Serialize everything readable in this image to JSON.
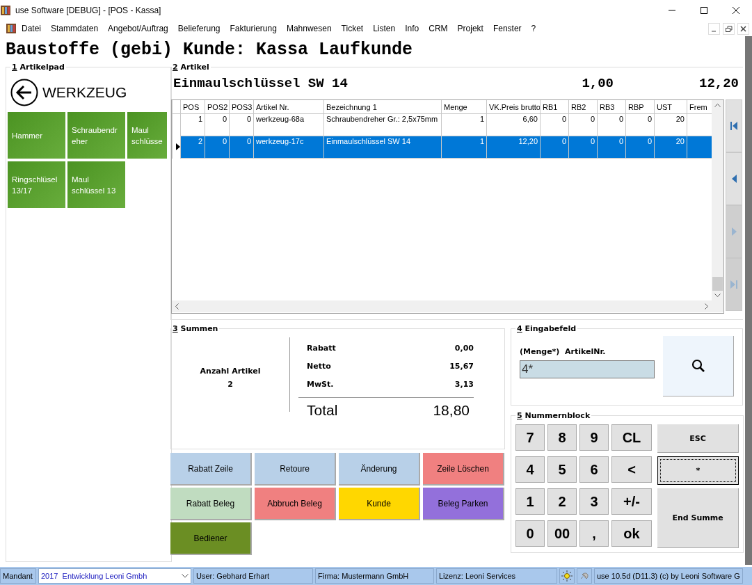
{
  "window": {
    "title": "use Software [DEBUG] - [POS - Kassa]"
  },
  "menu": [
    "Datei",
    "Stammdaten",
    "Angebot/Auftrag",
    "Belieferung",
    "Fakturierung",
    "Mahnwesen",
    "Ticket",
    "Listen",
    "Info",
    "CRM",
    "Projekt",
    "Fenster",
    "?"
  ],
  "heading": "Baustoffe (gebi) Kunde: Kassa Laufkunde",
  "artikelpad": {
    "key": "1",
    "title": "Artikelpad",
    "category": "WERKZEUG",
    "tiles": [
      {
        "label": "Hammer"
      },
      {
        "label": "Schraubendreher"
      },
      {
        "label": "Maul schlüsse"
      },
      {
        "label": "Ringschlüsel 13/17"
      },
      {
        "label": "Maul schlüssel 13"
      }
    ]
  },
  "artikel": {
    "key": "2",
    "title": "Artikel",
    "current": {
      "name": "Einmaulschlüssel  SW 14",
      "quantity": "1,00",
      "price": "12,20"
    },
    "table": {
      "columns": [
        "POS",
        "POS2",
        "POS3",
        "Artikel Nr.",
        "Bezeichnung 1",
        "Menge",
        "VK.Preis brutto",
        "RB1",
        "RB2",
        "RB3",
        "RBP",
        "UST",
        "Frem"
      ],
      "rows": [
        {
          "selected": false,
          "cells": [
            "1",
            "0",
            "0",
            "werkzeug-68a",
            "Schraubendreher Gr.: 2,5x75mm",
            "1",
            "6,60",
            "0",
            "0",
            "0",
            "0",
            "20",
            ""
          ]
        },
        {
          "selected": true,
          "cells": [
            "2",
            "0",
            "0",
            "werkzeug-17c",
            "Einmaulschlüssel  SW 14",
            "1",
            "12,20",
            "0",
            "0",
            "0",
            "0",
            "20",
            ""
          ]
        }
      ]
    },
    "nav": [
      {
        "kind": "first",
        "disabled": false
      },
      {
        "kind": "prev",
        "disabled": false
      },
      {
        "kind": "next",
        "disabled": true
      },
      {
        "kind": "last",
        "disabled": true
      }
    ]
  },
  "summen": {
    "key": "3",
    "title": "Summen",
    "count_label": "Anzahl Artikel",
    "count": "2",
    "lines": [
      {
        "label": "Rabatt",
        "value": "0,00"
      },
      {
        "label": "Netto",
        "value": "15,67"
      },
      {
        "label": "MwSt.",
        "value": "3,13"
      }
    ],
    "total": {
      "label": "Total",
      "value": "18,80"
    }
  },
  "actions": [
    {
      "label": "Rabatt Zeile",
      "color": "#b8d0e8"
    },
    {
      "label": "Retoure",
      "color": "#b8d0e8"
    },
    {
      "label": "Änderung",
      "color": "#b8d0e8"
    },
    {
      "label": "Zeile Löschen",
      "color": "#f08080"
    },
    {
      "label": "Rabatt Beleg",
      "color": "#c0dcc0"
    },
    {
      "label": "Abbruch Beleg",
      "color": "#f08080"
    },
    {
      "label": "Kunde",
      "color": "#ffd700"
    },
    {
      "label": "Beleg Parken",
      "color": "#9370db"
    },
    {
      "label": "Bediener",
      "color": "#6b8e23"
    }
  ],
  "eingabe": {
    "key": "4",
    "title": "Eingabefeld",
    "label": "(Menge*)  ArtikelNr.",
    "value": "4*"
  },
  "numpad": {
    "key": "5",
    "title": "Nummernblock",
    "keys": [
      "7",
      "8",
      "9",
      "CL",
      "4",
      "5",
      "6",
      "<",
      "1",
      "2",
      "3",
      "+/-",
      "0",
      "00",
      ",",
      "ok"
    ],
    "side_keys": [
      {
        "label": "ESC",
        "focused": false
      },
      {
        "label": "*",
        "focused": true
      },
      {
        "label": "End Summe",
        "focused": false
      }
    ]
  },
  "status_bar": {
    "mandant_label": "Mandant",
    "mandant_value": "2017  Entwicklung Leoni Gmbh",
    "user": "User: Gebhard Erhart",
    "firma": "Firma: Mustermann GmbH",
    "lizenz": "Lizenz: Leoni Services",
    "version": "use 10.5d (D11.3) (c) by Leoni Software G"
  }
}
